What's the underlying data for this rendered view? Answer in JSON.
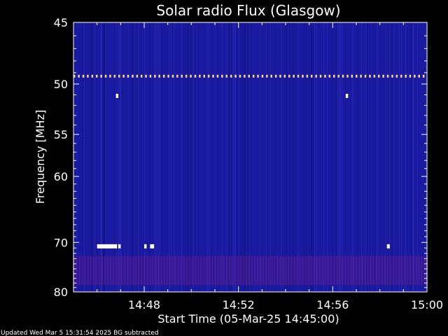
{
  "chart_data": {
    "type": "heatmap",
    "title": "Solar radio Flux (Glasgow)",
    "xlabel": "Start Time (05-Mar-25 14:45:00)",
    "ylabel": "Frequency [MHz]",
    "x_ticks": [
      "14:48",
      "14:52",
      "14:56",
      "15:00"
    ],
    "x_tick_minutes": [
      3,
      7,
      11,
      15
    ],
    "xlim_minutes": [
      0,
      15
    ],
    "y_ticks": [
      45,
      50,
      55,
      60,
      70,
      80
    ],
    "ylim": [
      45,
      80
    ],
    "background_color": "#1a1aa0",
    "features": [
      {
        "kind": "dashed-line",
        "freq": 49.3,
        "t_start": 0,
        "t_end": 15,
        "color": "#ffd27a"
      },
      {
        "kind": "band",
        "freq_start": 72.5,
        "freq_end": 78.5,
        "t_start": 0,
        "t_end": 15,
        "color": "#5a1a8a"
      },
      {
        "kind": "spot",
        "freq": 70.7,
        "t_start": 1.0,
        "t_end": 1.85,
        "color": "#ffffff"
      },
      {
        "kind": "spot",
        "freq": 70.7,
        "t_start": 1.9,
        "t_end": 2.0,
        "color": "#ffffff"
      },
      {
        "kind": "spot",
        "freq": 70.7,
        "t_start": 3.0,
        "t_end": 3.1,
        "color": "#ffffff"
      },
      {
        "kind": "spot",
        "freq": 70.7,
        "t_start": 3.25,
        "t_end": 3.42,
        "color": "#ffffff"
      },
      {
        "kind": "spot",
        "freq": 70.7,
        "t_start": 13.3,
        "t_end": 13.42,
        "color": "#ffffff"
      },
      {
        "kind": "spot",
        "freq": 51.1,
        "t_start": 1.8,
        "t_end": 1.9,
        "color": "#ffffff"
      },
      {
        "kind": "spot",
        "freq": 51.1,
        "t_start": 11.55,
        "t_end": 11.65,
        "color": "#ffffff"
      }
    ]
  },
  "footer": "Updated Wed Mar  5 15:31:54 2025   BG subtracted"
}
